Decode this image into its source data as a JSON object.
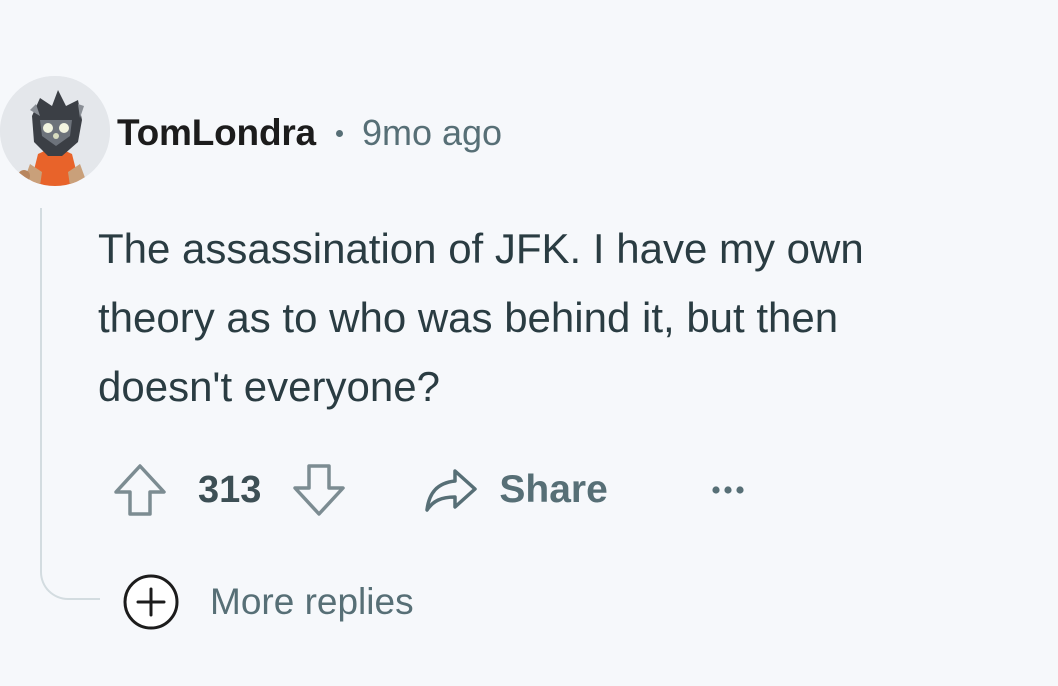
{
  "comment": {
    "author": "TomLondra",
    "separator": "•",
    "timestamp": "9mo ago",
    "body_lines": [
      "The assassination of JFK. I have my own",
      "theory as to who was behind it, but then",
      "doesn't everyone?"
    ],
    "score": "313",
    "share_label": "Share",
    "more_replies_label": "More replies"
  },
  "icons": {
    "upvote": "upvote-arrow-icon",
    "downvote": "downvote-arrow-icon",
    "share": "share-arrow-icon",
    "more": "ellipsis-icon",
    "more_replies": "plus-circle-icon"
  },
  "colors": {
    "background": "#f6f8fb",
    "username": "#1c1c1c",
    "meta": "#576f76",
    "body": "#2a3c42",
    "thread_line": "#d3dce0"
  }
}
